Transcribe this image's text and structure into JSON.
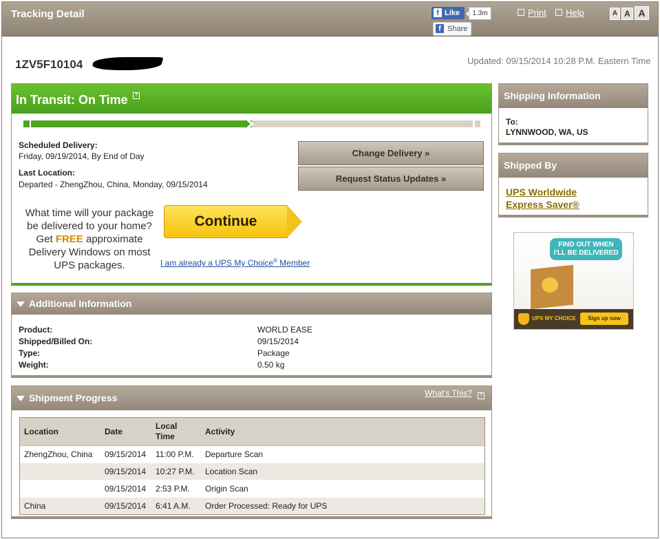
{
  "header": {
    "title": "Tracking Detail",
    "fb_like": "Like",
    "fb_like_icon": "f",
    "fb_count": "1.3m",
    "fb_share": "Share",
    "fb_share_icon": "f",
    "print": "Print",
    "help": "Help",
    "font_sizes": [
      "A",
      "A",
      "A"
    ]
  },
  "tracking": {
    "number": "1ZV5F10104",
    "updated": "Updated: 09/15/2014 10:28 P.M. Eastern Time"
  },
  "status": {
    "title": "In Transit: On Time",
    "progress_fraction": 0.5,
    "scheduled_label": "Scheduled Delivery:",
    "scheduled_value": "Friday, 09/19/2014, By End of Day",
    "last_location_label": "Last Location:",
    "last_location_value": "Departed - ZhengZhou, China, Monday, 09/15/2014",
    "change_delivery": "Change Delivery »",
    "request_updates": "Request Status Updates »",
    "promo_line1": "What time will your package",
    "promo_line2": "be delivered to your home?",
    "promo_get": "Get",
    "promo_free": "FREE",
    "promo_approx": "approximate",
    "promo_line4": "Delivery Windows on most",
    "promo_line5": "UPS packages.",
    "continue": "Continue",
    "mychoice_link_pre": "I am already a UPS My Choice",
    "mychoice_reg": "®",
    "mychoice_link_post": " Member"
  },
  "additional": {
    "title": "Additional Information",
    "rows": [
      {
        "label": "Product:",
        "value": "WORLD EASE"
      },
      {
        "label": "Shipped/Billed On:",
        "value": "09/15/2014"
      },
      {
        "label": "Type:",
        "value": "Package"
      },
      {
        "label": "Weight:",
        "value": "0.50 kg"
      }
    ]
  },
  "progress": {
    "title": "Shipment Progress",
    "whats_this": "What's This?",
    "headers": [
      "Location",
      "Date",
      "Local Time",
      "Activity"
    ],
    "rows": [
      [
        "ZhengZhou, China",
        "09/15/2014",
        "11:00 P.M.",
        "Departure Scan"
      ],
      [
        "",
        "09/15/2014",
        "10:27 P.M.",
        "Location Scan"
      ],
      [
        "",
        "09/15/2014",
        "2:53 P.M.",
        "Origin Scan"
      ],
      [
        "China",
        "09/15/2014",
        "6:41 A.M.",
        "Order Processed: Ready for UPS"
      ]
    ]
  },
  "sidebar": {
    "shipping_title": "Shipping Information",
    "to_label": "To:",
    "to_value": "LYNNWOOD, WA, US",
    "shipped_by_title": "Shipped By",
    "service_line1": "UPS Worldwide",
    "service_line2": "Express Saver®"
  },
  "ad": {
    "bubble_line1": "FIND OUT WHEN",
    "bubble_line2": "I'LL BE DELIVERED",
    "brand": "UPS MY CHOICE",
    "signup": "Sign up now"
  },
  "colors": {
    "header_brown": "#9d9282",
    "status_green": "#5db326",
    "promo_yellow": "#f7c20c",
    "link_blue": "#1a4fa3",
    "link_gold": "#8a6d00"
  }
}
